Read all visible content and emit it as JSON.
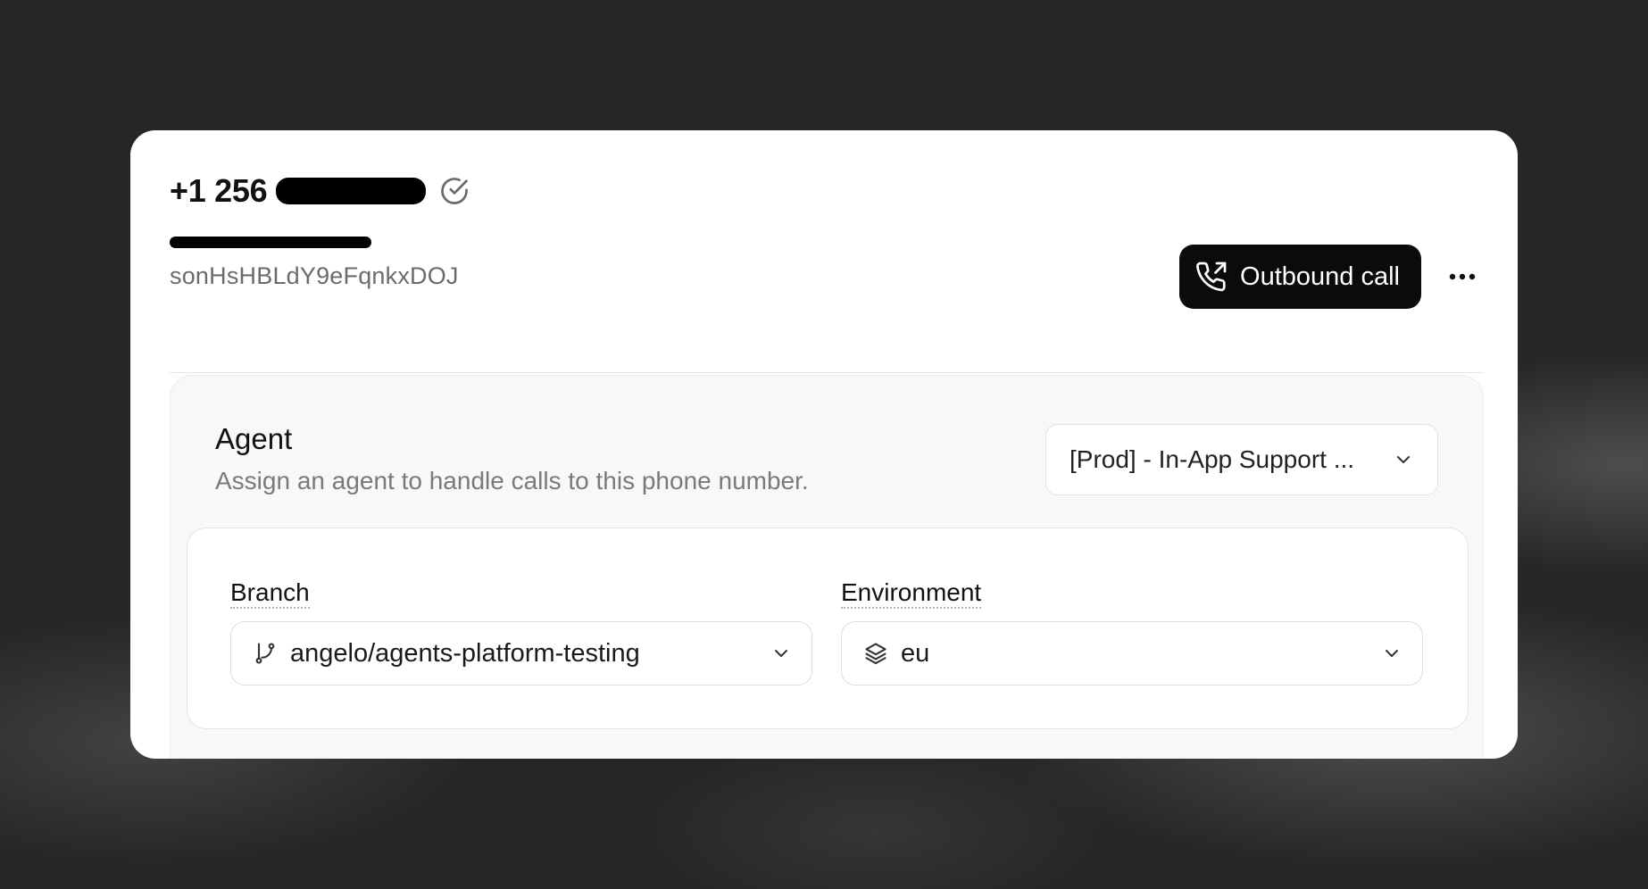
{
  "header": {
    "phone_number_prefix": "+1 256",
    "phone_id": "sonHsHBLdY9eFqnkxDOJ",
    "outbound_label": "Outbound call"
  },
  "agent": {
    "title": "Agent",
    "description": "Assign an agent to handle calls to this phone number.",
    "selected": "[Prod] - In-App Support ..."
  },
  "config": {
    "branch_label": "Branch",
    "branch_value": "angelo/agents-platform-testing",
    "environment_label": "Environment",
    "environment_value": "eu"
  },
  "icons": {
    "verified": "check-circle-icon",
    "outbound": "phone-outgoing-icon",
    "more": "more-horizontal-icon",
    "branch": "git-branch-icon",
    "environment": "layers-icon",
    "chevron": "chevron-down-icon"
  },
  "colors": {
    "background": "#262626",
    "card": "#ffffff",
    "primary_button": "#0b0b0b",
    "muted_text": "#7a7a7a"
  }
}
